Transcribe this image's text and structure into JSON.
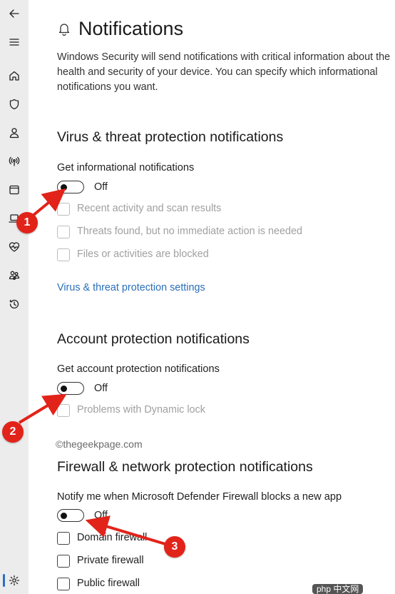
{
  "colors": {
    "accent": "#2a6fb8",
    "annotation": "#e2231a",
    "sidebar_bg": "#ececec"
  },
  "sidebar": {
    "items": [
      {
        "name": "back-arrow-icon"
      },
      {
        "name": "menu-icon"
      },
      {
        "name": "home-icon"
      },
      {
        "name": "shield-icon"
      },
      {
        "name": "person-icon"
      },
      {
        "name": "wireless-icon"
      },
      {
        "name": "app-browser-icon"
      },
      {
        "name": "laptop-icon"
      },
      {
        "name": "health-heart-icon"
      },
      {
        "name": "family-icon"
      },
      {
        "name": "history-icon"
      },
      {
        "name": "gear-icon"
      }
    ]
  },
  "page": {
    "title": "Notifications",
    "intro": "Windows Security will send notifications with critical information about the health and security of your device. You can specify which informational notifications you want."
  },
  "virus": {
    "title": "Virus & threat protection notifications",
    "toggle_label": "Get informational notifications",
    "toggle_state": "Off",
    "options": [
      "Recent activity and scan results",
      "Threats found, but no immediate action is needed",
      "Files or activities are blocked"
    ],
    "link": "Virus & threat protection settings"
  },
  "account": {
    "title": "Account protection notifications",
    "toggle_label": "Get account protection notifications",
    "toggle_state": "Off",
    "options": [
      "Problems with Dynamic lock"
    ]
  },
  "watermark": "©thegeekpage.com",
  "firewall": {
    "title": "Firewall & network protection notifications",
    "toggle_label": "Notify me when Microsoft Defender Firewall blocks a new app",
    "toggle_state": "Off",
    "options": [
      "Domain firewall",
      "Private firewall",
      "Public firewall"
    ]
  },
  "annotations": [
    "1",
    "2",
    "3"
  ],
  "php_watermark": "php 中文网"
}
